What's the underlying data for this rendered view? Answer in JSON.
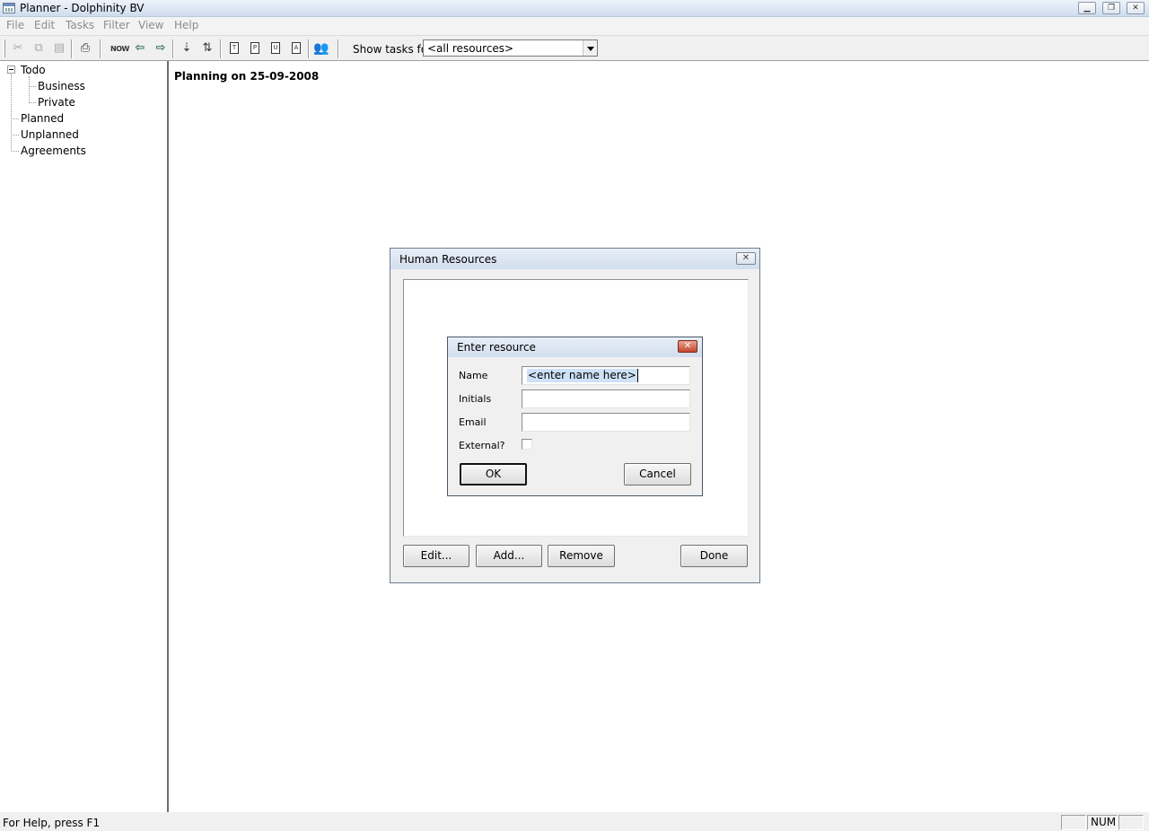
{
  "window": {
    "title": "Planner - Dolphinity BV"
  },
  "menubar": {
    "items": [
      "File",
      "Edit",
      "Tasks",
      "Filter",
      "View",
      "Help"
    ]
  },
  "toolbar": {
    "now_label": "NOW",
    "show_tasks_label": "Show tasks for",
    "resource_filter_value": "<all resources>"
  },
  "tree": {
    "items": [
      "Todo",
      "Business",
      "Private",
      "Planned",
      "Unplanned",
      "Agreements"
    ]
  },
  "main": {
    "planning_title": "Planning on 25-09-2008"
  },
  "hr_dialog": {
    "title": "Human Resources",
    "edit_label": "Edit...",
    "add_label": "Add...",
    "remove_label": "Remove",
    "done_label": "Done"
  },
  "resource_dialog": {
    "title": "Enter resource",
    "name_label": "Name",
    "name_value": "<enter name here>",
    "initials_label": "Initials",
    "initials_value": "",
    "email_label": "Email",
    "email_value": "",
    "external_label": "External?",
    "external_checked": false,
    "ok_label": "OK",
    "cancel_label": "Cancel"
  },
  "statusbar": {
    "help_text": "For Help, press F1",
    "num_indicator": "NUM"
  },
  "colors": {
    "titlebar": "#dbe6f4",
    "close_red": "#c4472d",
    "selection": "#cde1f7"
  }
}
